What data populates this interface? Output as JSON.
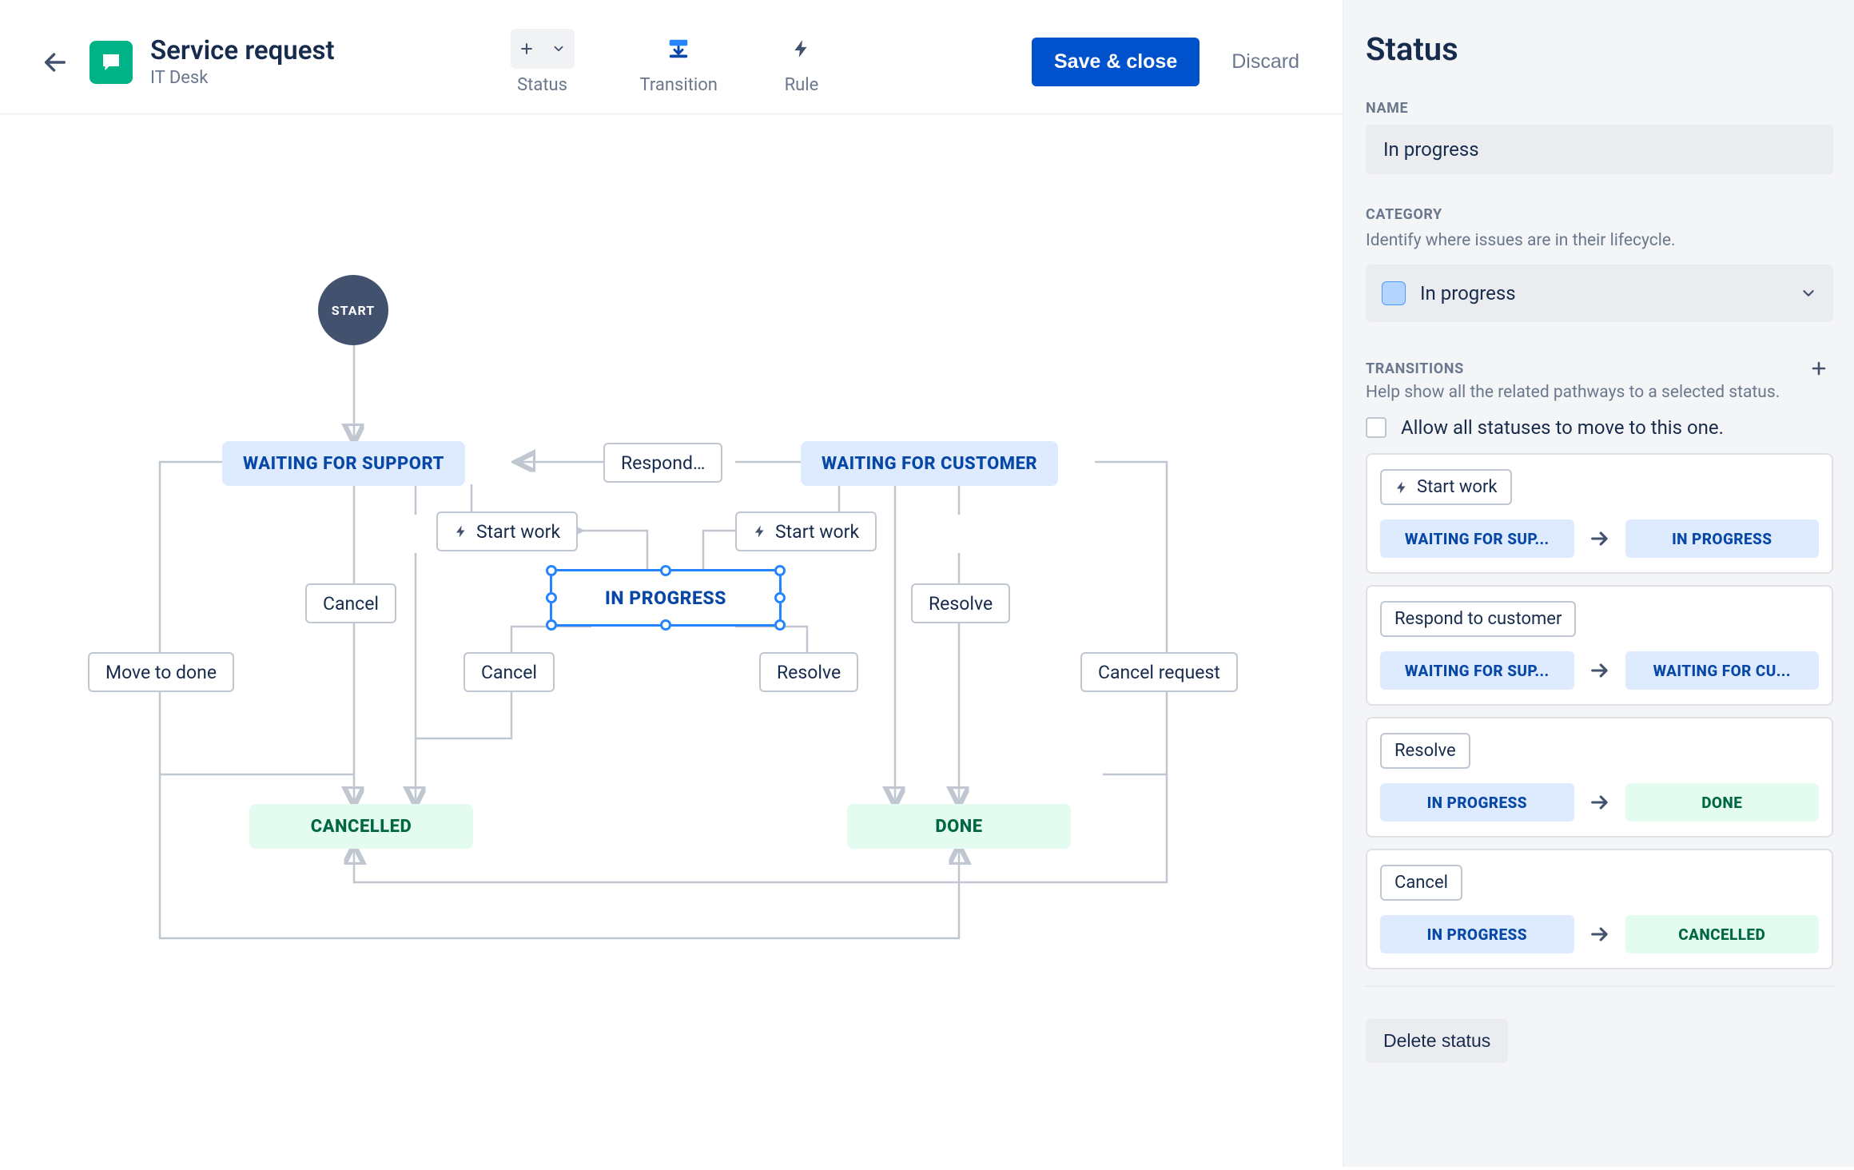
{
  "header": {
    "title": "Service request",
    "subtitle": "IT Desk",
    "tools": {
      "status": "Status",
      "transition": "Transition",
      "rule": "Rule"
    },
    "save": "Save & close",
    "discard": "Discard"
  },
  "workflow": {
    "start": "START",
    "nodes": {
      "waiting_support": "WAITING FOR SUPPORT",
      "waiting_customer": "WAITING FOR CUSTOMER",
      "in_progress": "IN PROGRESS",
      "cancelled": "CANCELLED",
      "done": "DONE"
    },
    "transitions": {
      "respond": "Respond…",
      "start_work_1": "Start work",
      "start_work_2": "Start work",
      "cancel_1": "Cancel",
      "cancel_2": "Cancel",
      "resolve_1": "Resolve",
      "resolve_2": "Resolve",
      "cancel_request": "Cancel request",
      "move_to_done": "Move to done"
    }
  },
  "panel": {
    "heading": "Status",
    "name_label": "NAME",
    "name_value": "In progress",
    "category_label": "CATEGORY",
    "category_help": "Identify where issues are in their lifecycle.",
    "category_value": "In progress",
    "transitions_label": "TRANSITIONS",
    "transitions_help": "Help show all the related pathways to a selected status.",
    "allow_all": "Allow all statuses to move to this one.",
    "cards": [
      {
        "name": "Start work",
        "bolt": true,
        "from": "WAITING FOR SUP...",
        "from_kind": "blue",
        "to": "IN PROGRESS",
        "to_kind": "blue"
      },
      {
        "name": "Respond to customer",
        "bolt": false,
        "from": "WAITING FOR SUP...",
        "from_kind": "blue",
        "to": "WAITING FOR CU...",
        "to_kind": "blue"
      },
      {
        "name": "Resolve",
        "bolt": false,
        "from": "IN PROGRESS",
        "from_kind": "blue",
        "to": "DONE",
        "to_kind": "green"
      },
      {
        "name": "Cancel",
        "bolt": false,
        "from": "IN PROGRESS",
        "from_kind": "blue",
        "to": "CANCELLED",
        "to_kind": "green"
      }
    ],
    "delete": "Delete status"
  }
}
